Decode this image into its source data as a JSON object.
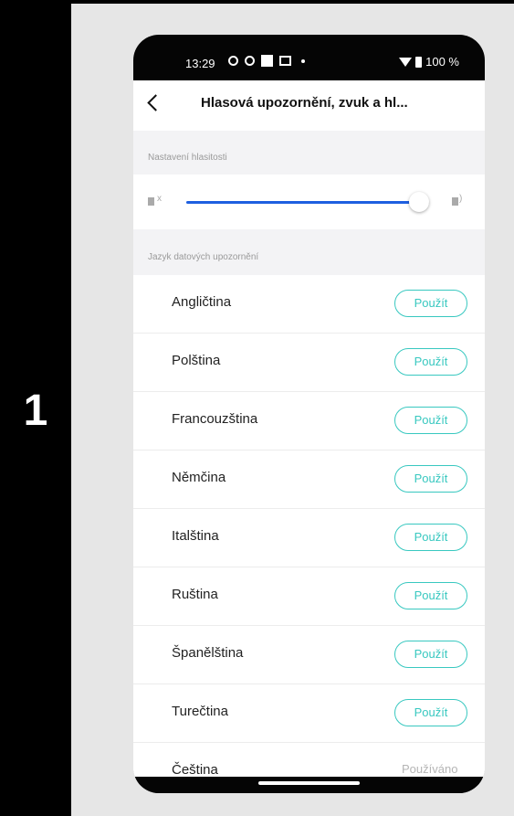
{
  "step_number": "1",
  "status_bar": {
    "time": "13:29",
    "battery": "100 %"
  },
  "header": {
    "title": "Hlasová upozornění, zvuk a hl..."
  },
  "volume": {
    "section_label": "Nastavení hlasitosti",
    "level_percent": 96
  },
  "languages": {
    "section_label": "Jazyk datových upozornění",
    "use_label": "Použít",
    "items": [
      {
        "name": "Angličtina",
        "action": "Použít"
      },
      {
        "name": "Polština",
        "action": "Použít"
      },
      {
        "name": "Francouzština",
        "action": "Použít"
      },
      {
        "name": "Němčina",
        "action": "Použít"
      },
      {
        "name": "Italština",
        "action": "Použít"
      },
      {
        "name": "Ruština",
        "action": "Použít"
      },
      {
        "name": "Španělština",
        "action": "Použít"
      },
      {
        "name": "Turečtina",
        "action": "Použít"
      },
      {
        "name": "Čeština",
        "status": "Používáno"
      }
    ]
  },
  "colors": {
    "accent_teal": "#38c8c0",
    "slider_blue": "#1e5fe0"
  }
}
